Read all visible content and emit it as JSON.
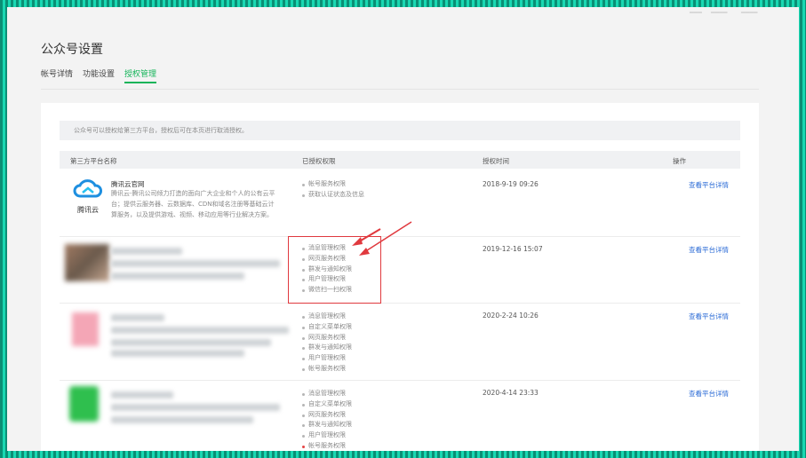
{
  "page": {
    "title": "公众号设置"
  },
  "tabs": [
    "帐号详情",
    "功能设置",
    "授权管理"
  ],
  "notice": "公众号可以授权给第三方平台，授权后可在本页进行取消授权。",
  "table": {
    "headers": [
      "第三方平台名称",
      "已授权权限",
      "授权时间",
      "操作"
    ],
    "rows": [
      {
        "name": "腾讯云官网",
        "logo_text": "腾讯云",
        "desc": "腾讯云-腾讯公司倾力打造的面向广大企业和个人的公有云平台；提供云服务器、云数据库、CDN和域名注册等基础云计算服务，以及提供游戏、视频、移动应用等行业解决方案。",
        "perms": [
          "帐号服务权限",
          "获取认证状态及信息"
        ],
        "time": "2018-9-19 09:26",
        "action": "查看平台详情"
      },
      {
        "name": "",
        "perms": [
          "消息管理权限",
          "网页服务权限",
          "群发与通知权限",
          "用户管理权限",
          "微信扫一扫权限"
        ],
        "time": "2019-12-16 15:07",
        "action": "查看平台详情"
      },
      {
        "name": "",
        "perms": [
          "消息管理权限",
          "自定义菜单权限",
          "网页服务权限",
          "群发与通知权限",
          "用户管理权限",
          "帐号服务权限"
        ],
        "time": "2020-2-24 10:26",
        "action": "查看平台详情"
      },
      {
        "name": "",
        "perms": [
          "消息管理权限",
          "自定义菜单权限",
          "网页服务权限",
          "群发与通知权限",
          "用户管理权限",
          "帐号服务权限"
        ],
        "time": "2020-4-14 23:33",
        "action": "查看平台详情"
      }
    ]
  },
  "colors": {
    "accent": "#16b45a",
    "link": "#2b6bd6",
    "highlight": "#e0393e",
    "frame": "#11c4a0"
  }
}
